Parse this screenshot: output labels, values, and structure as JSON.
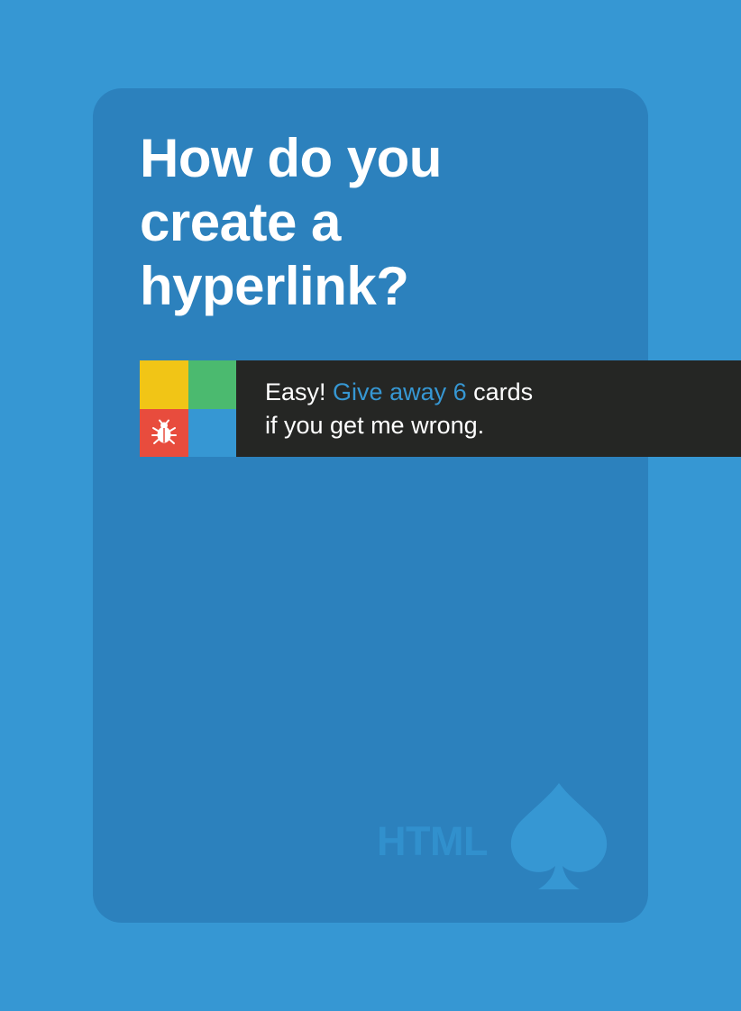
{
  "card": {
    "question_lines": [
      "How do you",
      "create a",
      "hyperlink?"
    ],
    "penalty": {
      "lead": "Easy!",
      "highlight": "Give away 6",
      "tail": "cards",
      "line2": "if you get me wrong."
    },
    "deck_label": "HTML",
    "icons": {
      "suit": "spade-icon",
      "badge": "bug-icon"
    }
  },
  "colors": {
    "background": "#3697d3",
    "card": "#2c81bd",
    "banner": "#252624",
    "accent": "#3697d3",
    "logo_yellow": "#f1c516",
    "logo_green": "#4bba6f",
    "logo_red": "#e84c3d",
    "logo_blue": "#3697d3",
    "deck_label": "#3190cd",
    "spade": "#3697d3"
  }
}
